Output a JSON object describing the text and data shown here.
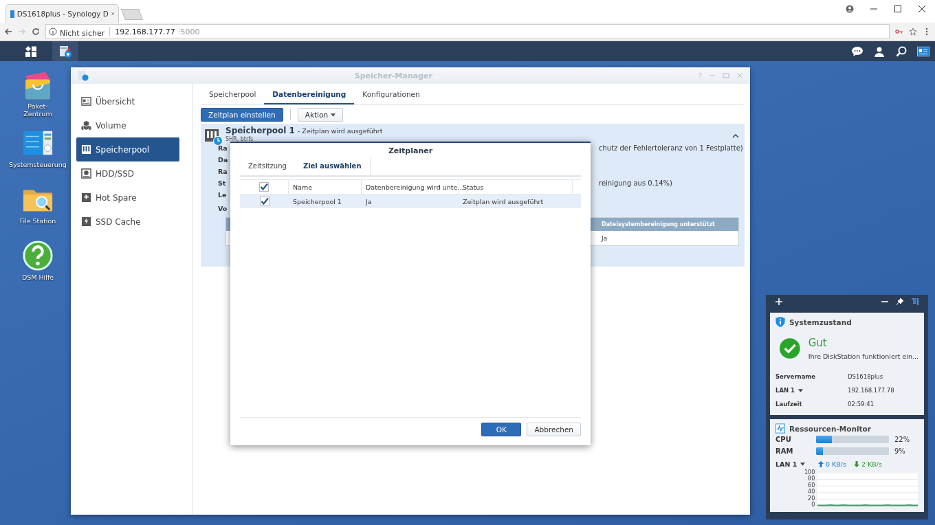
{
  "browser": {
    "tab_title": "DS1618plus - Synology D",
    "security": "Nicht sicher",
    "url_host": "192.168.177.77",
    "url_port": ":5000"
  },
  "desktop_icons": [
    {
      "label": "Paket-Zentrum",
      "kind": "package"
    },
    {
      "label": "Systemsteuerung",
      "kind": "control"
    },
    {
      "label": "File Station",
      "kind": "folder"
    },
    {
      "label": "DSM Hilfe",
      "kind": "help"
    }
  ],
  "window": {
    "title": "Speicher-Manager",
    "help_label": "?",
    "sidebar": [
      {
        "label": "Übersicht",
        "kind": "overview",
        "selected": false
      },
      {
        "label": "Volume",
        "kind": "volume",
        "selected": false
      },
      {
        "label": "Speicherpool",
        "kind": "pool",
        "selected": true
      },
      {
        "label": "HDD/SSD",
        "kind": "disk",
        "selected": false
      },
      {
        "label": "Hot Spare",
        "kind": "spare",
        "selected": false
      },
      {
        "label": "SSD Cache",
        "kind": "cache",
        "selected": false
      }
    ],
    "tabs": [
      {
        "label": "Speicherpool",
        "selected": false
      },
      {
        "label": "Datenbereinigung",
        "selected": true
      },
      {
        "label": "Konfigurationen",
        "selected": false
      }
    ],
    "toolbar": {
      "primary": "Zeitplan einstellen",
      "menu": "Aktion"
    },
    "pool": {
      "name": "Speicherpool 1",
      "status": "- Zeitplan wird ausgeführt",
      "subtitle": "SHR, btrfs",
      "expanded": true,
      "details": [
        {
          "label": "Ra",
          "value": "chutz der Fehlertoleranz von 1 Festplatte)"
        },
        {
          "label": "Da"
        },
        {
          "label": "Ra"
        },
        {
          "label": "St",
          "value": "reinigung aus 0.14%)"
        },
        {
          "label": "Le"
        }
      ],
      "section": "Vo",
      "table_header": "Dateisystembereinigung unterstützt",
      "table_cell": "Ja"
    }
  },
  "dialog": {
    "title": "Zeitplaner",
    "tabs": [
      {
        "label": "Zeitsitzung",
        "selected": false
      },
      {
        "label": "Ziel auswählen",
        "selected": true
      }
    ],
    "all_checked": true,
    "columns": [
      "Name",
      "Datenbereinigung wird unte...",
      "Status"
    ],
    "rows": [
      {
        "checked": true,
        "selected": true,
        "cells": [
          "Speicherpool 1",
          "Ja",
          "Zeitplan wird ausgeführt"
        ]
      }
    ],
    "buttons": [
      "OK",
      "Abbrechen"
    ]
  },
  "widgets": {
    "health": {
      "title": "Systemzustand",
      "state": "Gut",
      "message": "Ihre DiskStation funktioniert ein...",
      "rows": [
        {
          "label": "Servername",
          "value": "DS1618plus",
          "dropdown": false
        },
        {
          "label": "LAN 1",
          "value": "192.168.177.78",
          "dropdown": true
        },
        {
          "label": "Laufzeit",
          "value": "02:59:41",
          "dropdown": false
        }
      ]
    },
    "monitor": {
      "title": "Ressourcen-Monitor",
      "meters": [
        {
          "label": "CPU",
          "level": 0.22,
          "reading": "22%"
        },
        {
          "label": "RAM",
          "level": 0.09,
          "reading": "9%"
        }
      ],
      "lan": "LAN 1",
      "upload": "0 KB/s",
      "download": "2 KB/s",
      "chart_data": {
        "type": "area",
        "grid": true,
        "ylim": [
          0,
          100
        ],
        "yticks": [
          0,
          20,
          40,
          60,
          80,
          100
        ],
        "series": [
          {
            "color": "#2e8b57",
            "values": [
              2,
              2,
              2,
              3,
              2,
              2,
              3,
              2,
              2,
              2,
              2,
              3,
              2,
              2,
              2,
              2,
              3,
              2,
              2,
              2,
              2,
              3,
              2,
              2
            ]
          }
        ]
      }
    }
  }
}
